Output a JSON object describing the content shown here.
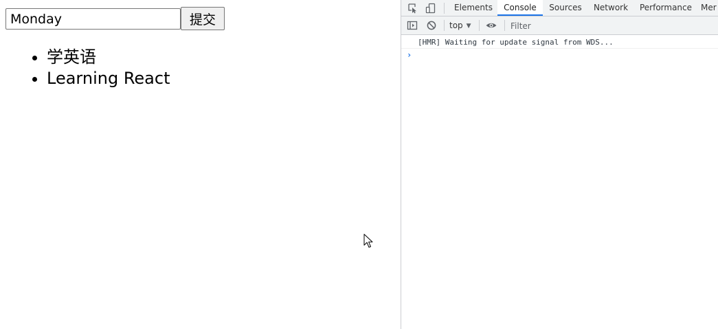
{
  "page": {
    "input_value": "Monday",
    "submit_label": "提交",
    "todos": [
      "学英语",
      "Learning React"
    ]
  },
  "devtools": {
    "tabs": [
      {
        "label": "Elements",
        "active": false
      },
      {
        "label": "Console",
        "active": true
      },
      {
        "label": "Sources",
        "active": false
      },
      {
        "label": "Network",
        "active": false
      },
      {
        "label": "Performance",
        "active": false
      },
      {
        "label": "Mer",
        "active": false
      }
    ],
    "context": "top",
    "filter_placeholder": "Filter",
    "messages": [
      "[HMR] Waiting for update signal from WDS..."
    ],
    "prompt": "›",
    "icons": {
      "inspect": "inspect-element-icon",
      "device": "device-toolbar-icon",
      "sidebar": "console-sidebar-icon",
      "clear": "clear-console-icon",
      "eye": "live-expression-eye-icon",
      "dropdown": "dropdown-arrow-icon"
    }
  }
}
